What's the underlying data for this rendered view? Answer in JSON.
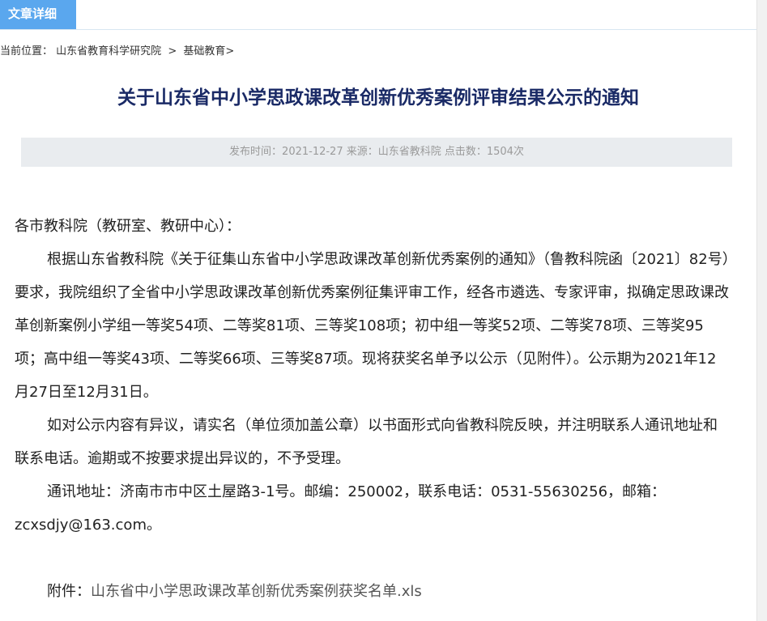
{
  "tab": {
    "label": "文章详细"
  },
  "breadcrumb": {
    "prefix": "当前位置：",
    "items": [
      "山东省教育科学研究院",
      "基础教育"
    ],
    "separator": ">",
    "trailing": ">"
  },
  "article": {
    "title": "关于山东省中小学思政课改革创新优秀案例评审结果公示的通知",
    "meta": "发布时间：2021-12-27 来源：山东省教科院 点击数：1504次",
    "paragraphs": [
      "各市教科院（教研室、教研中心）：",
      "根据山东省教科院《关于征集山东省中小学思政课改革创新优秀案例的通知》（鲁教科院函〔2021〕82号）要求，我院组织了全省中小学思政课改革创新优秀案例征集评审工作，经各市遴选、专家评审，拟确定思政课改革创新案例小学组一等奖54项、二等奖81项、三等奖108项；初中组一等奖52项、二等奖78项、三等奖95项；高中组一等奖43项、二等奖66项、三等奖87项。现将获奖名单予以公示（见附件）。公示期为2021年12月27日至12月31日。",
      "如对公示内容有异议，请实名（单位须加盖公章）以书面形式向省教科院反映，并注明联系人通讯地址和联系电话。逾期或不按要求提出异议的，不予受理。",
      "通讯地址：济南市市中区土屋路3-1号。邮编：250002，联系电话：0531-55630256，邮箱：zcxsdjy@163.com。"
    ],
    "attachment": {
      "label": "附件：",
      "filename": "山东省中小学思政课改革创新优秀案例获奖名单.xls"
    }
  },
  "colors": {
    "tab_bg": "#5aa7ee",
    "title": "#1a2a66",
    "meta_bg": "#e9ecef"
  }
}
